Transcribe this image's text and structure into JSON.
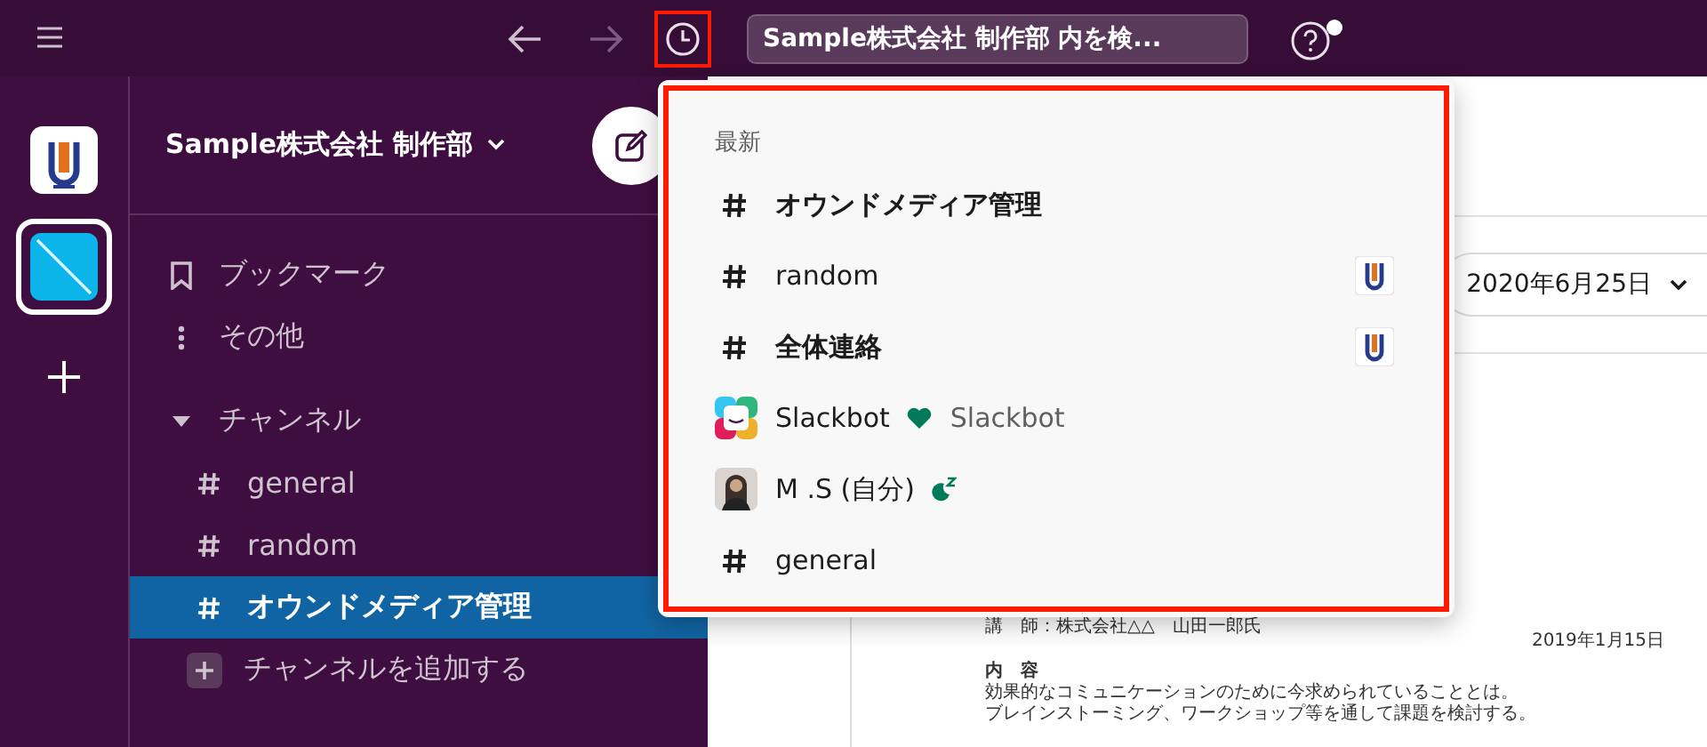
{
  "topbar": {
    "forward_disabled": true,
    "history_highlighted": true,
    "search": {
      "value": "Sample株式会社 制作部 内を検..."
    },
    "help_notification": true
  },
  "workspaces": [
    {
      "kind": "logo",
      "selected": false
    },
    {
      "kind": "stripe",
      "selected": true
    }
  ],
  "sidebar": {
    "workspace_name": "Sample株式会社 制作部",
    "nav": [
      {
        "kind": "bookmark",
        "label": "ブックマーク"
      },
      {
        "kind": "more",
        "label": "その他"
      }
    ],
    "section": {
      "label": "チャンネル",
      "expanded": true,
      "channels": [
        {
          "name": "general",
          "selected": false
        },
        {
          "name": "random",
          "selected": false
        },
        {
          "name": "オウンドメディア管理",
          "selected": true
        }
      ],
      "add_label": "チャンネルを追加する"
    }
  },
  "main": {
    "date": "2020年6月25日",
    "document": {
      "date": "2019年1月15日",
      "lecturer": "講　師：株式会社△△　山田一郎氏",
      "heading": "内　容",
      "lines": [
        "効果的なコミュニケーションのために今求められていることとは。",
        "ブレインストーミング、ワークショップ等を通して課題を検討する。"
      ]
    }
  },
  "popup": {
    "highlighted": true,
    "heading": "最新",
    "items": [
      {
        "kind": "channel",
        "label": "オウンドメディア管理",
        "unread": true,
        "workspace_badge": false
      },
      {
        "kind": "channel",
        "label": "random",
        "unread": false,
        "workspace_badge": true
      },
      {
        "kind": "channel",
        "label": "全体連絡",
        "unread": true,
        "workspace_badge": true
      },
      {
        "kind": "bot",
        "label": "Slackbot",
        "detail": "Slackbot"
      },
      {
        "kind": "user",
        "label": "M .S (自分)"
      },
      {
        "kind": "channel",
        "label": "general",
        "unread": false,
        "workspace_badge": false
      }
    ]
  }
}
